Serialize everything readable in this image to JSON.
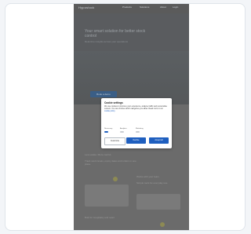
{
  "page": {
    "logo": "Hypostock",
    "nav": [
      "Products",
      "Solutions",
      "About",
      "Login"
    ],
    "hero": {
      "title": "Your smart solution for better stock control",
      "subtitle": "Real-time insights across your operations",
      "cta": "Book a demo"
    },
    "sections": [
      {
        "heading": "Less waste. More control.",
        "body": "Track stock levels, expiry dates and orders in one place."
      },
      {
        "heading": "Works with your team",
        "body": "Simple tools for everyday use."
      },
      {
        "heading": "Built for hospitality and retail",
        "body": ""
      }
    ]
  },
  "cookie_modal": {
    "title": "Cookie settings",
    "body": "We use cookies to improve your experience, analyse traffic and personalise content. You can choose which categories you allow. Read more in our",
    "link": "cookie policy",
    "preferences": [
      {
        "label": "Necessary",
        "on": true
      },
      {
        "label": "Analytics",
        "on": false
      },
      {
        "label": "Marketing",
        "on": false
      }
    ],
    "buttons": {
      "customize": "Customize",
      "decline": "Decline",
      "accept": "Accept all"
    }
  },
  "colors": {
    "overlay": "#6b6b6b",
    "primary": "#1f5fbf",
    "accent_dot": "#8d8a54"
  }
}
